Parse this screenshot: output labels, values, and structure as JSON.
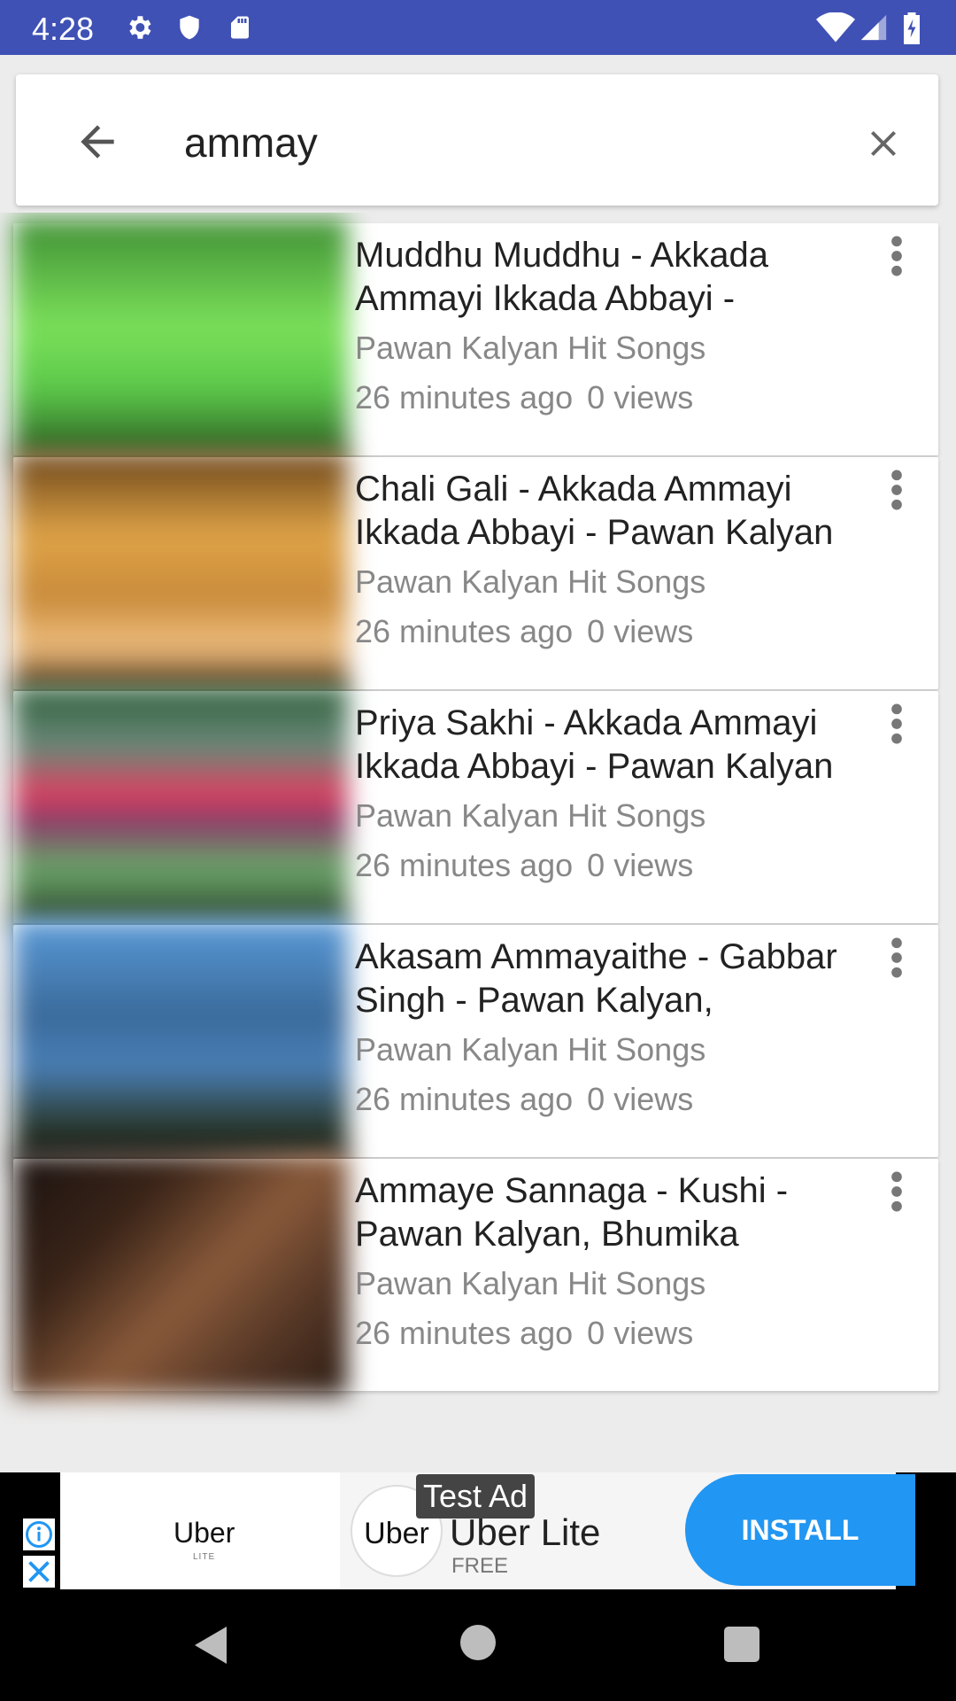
{
  "status_bar": {
    "time": "4:28",
    "icons": [
      "gear-icon",
      "shield-icon",
      "sd-card-icon",
      "wifi-icon",
      "signal-icon",
      "battery-icon"
    ],
    "background": "#3f51b5"
  },
  "search": {
    "query": "ammay",
    "back_icon": "arrow-left-icon",
    "clear_icon": "close-icon"
  },
  "results": [
    {
      "title": "Muddhu Muddhu - Akkada Ammayi Ikkada Abbayi -",
      "channel": "Pawan Kalyan Hit Songs",
      "time": "26 minutes ago",
      "views": "0 views",
      "thumb_colors": [
        "#4ca63a",
        "#7be05a",
        "#3a7a2c"
      ]
    },
    {
      "title": "Chali Gali - Akkada Ammayi Ikkada Abbayi - Pawan Kalyan",
      "channel": "Pawan Kalyan Hit Songs",
      "time": "26 minutes ago",
      "views": "0 views",
      "thumb_colors": [
        "#8a5a20",
        "#e0a448",
        "#5a3414"
      ]
    },
    {
      "title": "Priya Sakhi - Akkada Ammayi Ikkada Abbayi - Pawan Kalyan",
      "channel": "Pawan Kalyan Hit Songs",
      "time": "26 minutes ago",
      "views": "0 views",
      "thumb_colors": [
        "#3a6e4a",
        "#e04060",
        "#2e5e3a"
      ]
    },
    {
      "title": "Akasam Ammayaithe - Gabbar Singh - Pawan Kalyan,",
      "channel": "Pawan Kalyan Hit Songs",
      "time": "26 minutes ago",
      "views": "0 views",
      "thumb_colors": [
        "#2a4a70",
        "#5a9ad8",
        "#1a2a36"
      ]
    },
    {
      "title": "Ammaye Sannaga - Kushi - Pawan Kalyan, Bhumika",
      "channel": "Pawan Kalyan Hit Songs",
      "time": "26 minutes ago",
      "views": "0 views",
      "thumb_colors": [
        "#3a2418",
        "#8a5a3a",
        "#1a1210"
      ]
    }
  ],
  "ad": {
    "badge": "Test Ad",
    "left_logo": "Uber",
    "left_sub": "LITE",
    "circle_logo": "Uber",
    "title": "Uber Lite",
    "subtitle": "FREE",
    "install": "INSTALL",
    "accent": "#2196f3"
  },
  "nav": {
    "back_icon": "back-triangle-icon",
    "home_icon": "home-circle-icon",
    "recents_icon": "recents-square-icon"
  }
}
